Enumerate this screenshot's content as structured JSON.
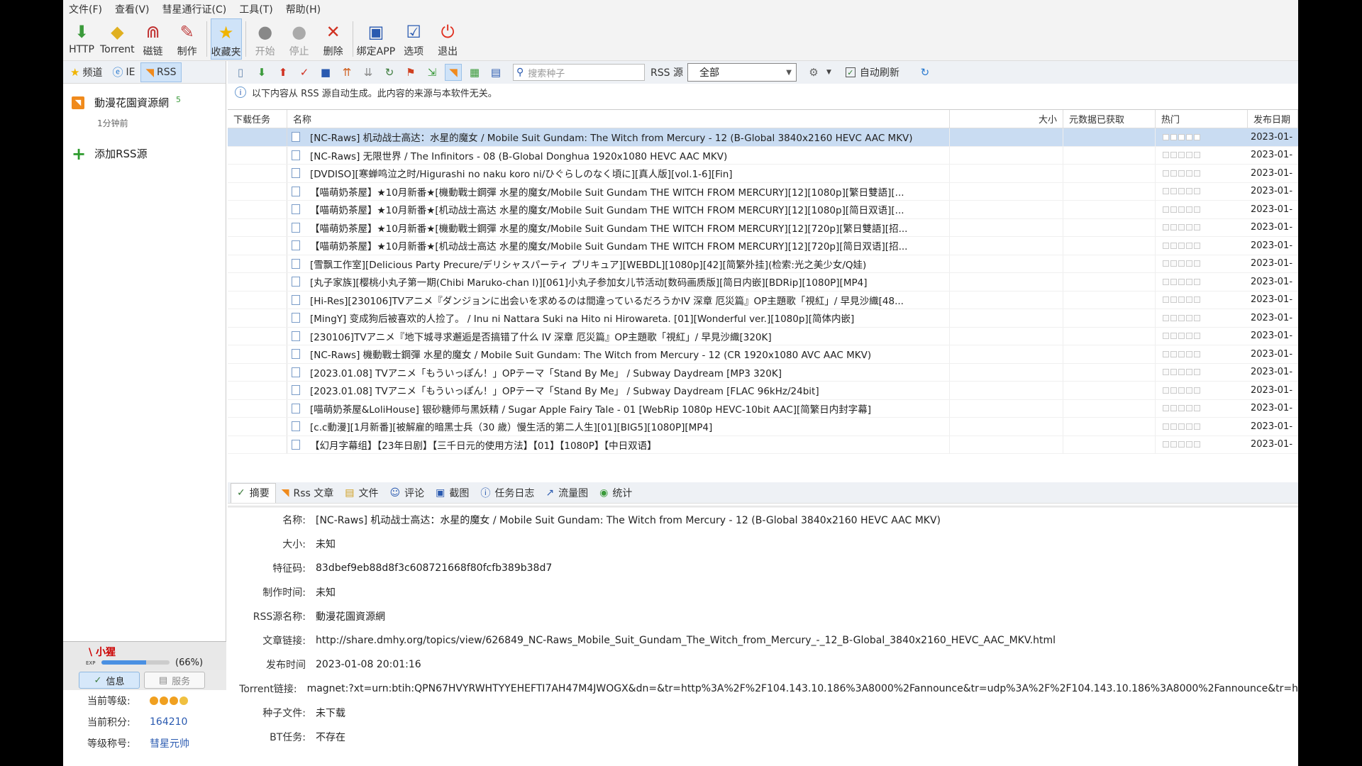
{
  "menu": [
    "文件(F)",
    "查看(V)",
    "彗星通行证(C)",
    "工具(T)",
    "帮助(H)"
  ],
  "toolbar": {
    "http": "HTTP",
    "torrent": "Torrent",
    "magnet": "磁链",
    "make": "制作",
    "favorites": "收藏夹",
    "start": "开始",
    "stop": "停止",
    "delete": "删除",
    "bind_app": "绑定APP",
    "options": "选项",
    "exit": "退出"
  },
  "sidebar": {
    "tabs": [
      "频道",
      "IE",
      "RSS"
    ],
    "feed": {
      "name": "動漫花園資源網",
      "count": "5",
      "time": "1分钟前"
    },
    "add_rss": "添加RSS源"
  },
  "user": {
    "name": "\\ 小猩",
    "exp_label": "EXP",
    "exp_pct": "(66%)",
    "exp_value": 0.66,
    "btn_info": "信息",
    "btn_service": "服务",
    "level_label": "当前等级:",
    "points_label": "当前积分:",
    "points": "164210",
    "title_label": "等级称号:",
    "title": "彗星元帅"
  },
  "subtoolbar": {
    "search_placeholder": "搜索种子",
    "rss_label": "RSS 源",
    "rss_selected": "全部",
    "auto_refresh": "自动刷新"
  },
  "notice": "以下内容从 RSS 源自动生成。此内容的来源与本软件无关。",
  "table": {
    "headers": {
      "task": "下载任务",
      "name": "名称",
      "size": "大小",
      "meta": "元数据已获取",
      "hot": "热门",
      "date": "发布日期"
    },
    "rows": [
      {
        "name": "[NC-Raws] 机动战士高达：水星的魔女 / Mobile Suit Gundam: The Witch from Mercury - 12 (B-Global 3840x2160 HEVC AAC MKV)",
        "date": "2023-01-"
      },
      {
        "name": "[NC-Raws] 无限世界 / The Infinitors - 08 (B-Global Donghua 1920x1080 HEVC AAC MKV)",
        "date": "2023-01-"
      },
      {
        "name": "[DVDISO][寒蝉鸣泣之时/Higurashi no naku koro ni/ひぐらしのなく頃に][真人版][vol.1-6][Fin]",
        "date": "2023-01-"
      },
      {
        "name": "【喵萌奶茶屋】★10月新番★[機動戰士鋼彈 水星的魔女/Mobile Suit Gundam THE WITCH FROM MERCURY][12][1080p][繁日雙語][...",
        "date": "2023-01-"
      },
      {
        "name": "【喵萌奶茶屋】★10月新番★[机动战士高达 水星的魔女/Mobile Suit Gundam THE WITCH FROM MERCURY][12][1080p][简日双语][...",
        "date": "2023-01-"
      },
      {
        "name": "【喵萌奶茶屋】★10月新番★[機動戰士鋼彈 水星的魔女/Mobile Suit Gundam THE WITCH FROM MERCURY][12][720p][繁日雙語][招...",
        "date": "2023-01-"
      },
      {
        "name": "【喵萌奶茶屋】★10月新番★[机动战士高达 水星的魔女/Mobile Suit Gundam THE WITCH FROM MERCURY][12][720p][简日双语][招...",
        "date": "2023-01-"
      },
      {
        "name": "[雪飘工作室][Delicious Party Precure/デリシャスパーティ プリキュア][WEBDL][1080p][42][简繁外挂](检索:光之美少女/Q娃)",
        "date": "2023-01-"
      },
      {
        "name": "[丸子家族][樱桃小丸子第一期(Chibi Maruko-chan I)][061]小丸子参加女儿节活动[数码画质版][简日内嵌][BDRip][1080P][MP4]",
        "date": "2023-01-"
      },
      {
        "name": "[Hi-Res][230106]TVアニメ『ダンジョンに出会いを求めるのは間違っているだろうかIV 深章 厄災篇』OP主題歌「視紅」/ 早見沙織[48...",
        "date": "2023-01-"
      },
      {
        "name": "[MingY] 变成狗后被喜欢的人捡了。 / Inu ni Nattara Suki na Hito ni Hirowareta. [01][Wonderful ver.][1080p][简体内嵌]",
        "date": "2023-01-"
      },
      {
        "name": "[230106]TVアニメ『地下城寻求邂逅是否搞错了什么 IV 深章 厄災篇』OP主題歌「視紅」/ 早見沙織[320K]",
        "date": "2023-01-"
      },
      {
        "name": "[NC-Raws] 機動戰士鋼彈 水星的魔女 / Mobile Suit Gundam: The Witch from Mercury - 12 (CR 1920x1080 AVC AAC MKV)",
        "date": "2023-01-"
      },
      {
        "name": "[2023.01.08] TVアニメ「もういっぽん！」OPテーマ「Stand By Me」 / Subway Daydream [MP3 320K]",
        "date": "2023-01-"
      },
      {
        "name": "[2023.01.08] TVアニメ「もういっぽん！」OPテーマ「Stand By Me」 / Subway Daydream [FLAC 96kHz/24bit]",
        "date": "2023-01-"
      },
      {
        "name": "[喵萌奶茶屋&LoliHouse] 银砂糖师与黑妖精 / Sugar Apple Fairy Tale - 01 [WebRip 1080p HEVC-10bit AAC][简繁日内封字幕]",
        "date": "2023-01-"
      },
      {
        "name": "[c.c動漫][1月新番][被解雇的暗黑士兵（30 歲）慢生活的第二人生][01][BIG5][1080P][MP4]",
        "date": "2023-01-"
      },
      {
        "name": "【幻月字幕组】【23年日剧】【三千日元的使用方法】【01】【1080P】【中日双语】",
        "date": "2023-01-"
      }
    ]
  },
  "detail_tabs": [
    "摘要",
    "Rss 文章",
    "文件",
    "评论",
    "截图",
    "任务日志",
    "流量图",
    "统计"
  ],
  "details": [
    {
      "k": "名称:",
      "v": "[NC-Raws] 机动战士高达：水星的魔女 / Mobile Suit Gundam: The Witch from Mercury - 12 (B-Global 3840x2160 HEVC AAC MKV)"
    },
    {
      "k": "大小:",
      "v": "未知"
    },
    {
      "k": "特征码:",
      "v": "83dbef9eb88d8f3c608721668f80fcfb389b38d7"
    },
    {
      "k": "制作时间:",
      "v": "未知"
    },
    {
      "k": "RSS源名称:",
      "v": "動漫花園資源網"
    },
    {
      "k": "文章链接:",
      "v": "http://share.dmhy.org/topics/view/626849_NC-Raws_Mobile_Suit_Gundam_The_Witch_from_Mercury_-_12_B-Global_3840x2160_HEVC_AAC_MKV.html"
    },
    {
      "k": "发布时间",
      "v": "2023-01-08 20:01:16"
    },
    {
      "k": "Torrent链接:",
      "v": "magnet:?xt=urn:btih:QPN67HVYRWHTYYEHEFTI7AH47M4JWOGX&dn=&tr=http%3A%2F%2F104.143.10.186%3A8000%2Fannounce&tr=udp%3A%2F%2F104.143.10.186%3A8000%2Fannounce&tr=h"
    },
    {
      "k": "种子文件:",
      "v": "未下载"
    },
    {
      "k": "BT任务:",
      "v": "不存在"
    }
  ],
  "colors": {
    "selection": "#c9dcf2",
    "accent": "#4a90e2",
    "rss": "#f08a1c"
  }
}
